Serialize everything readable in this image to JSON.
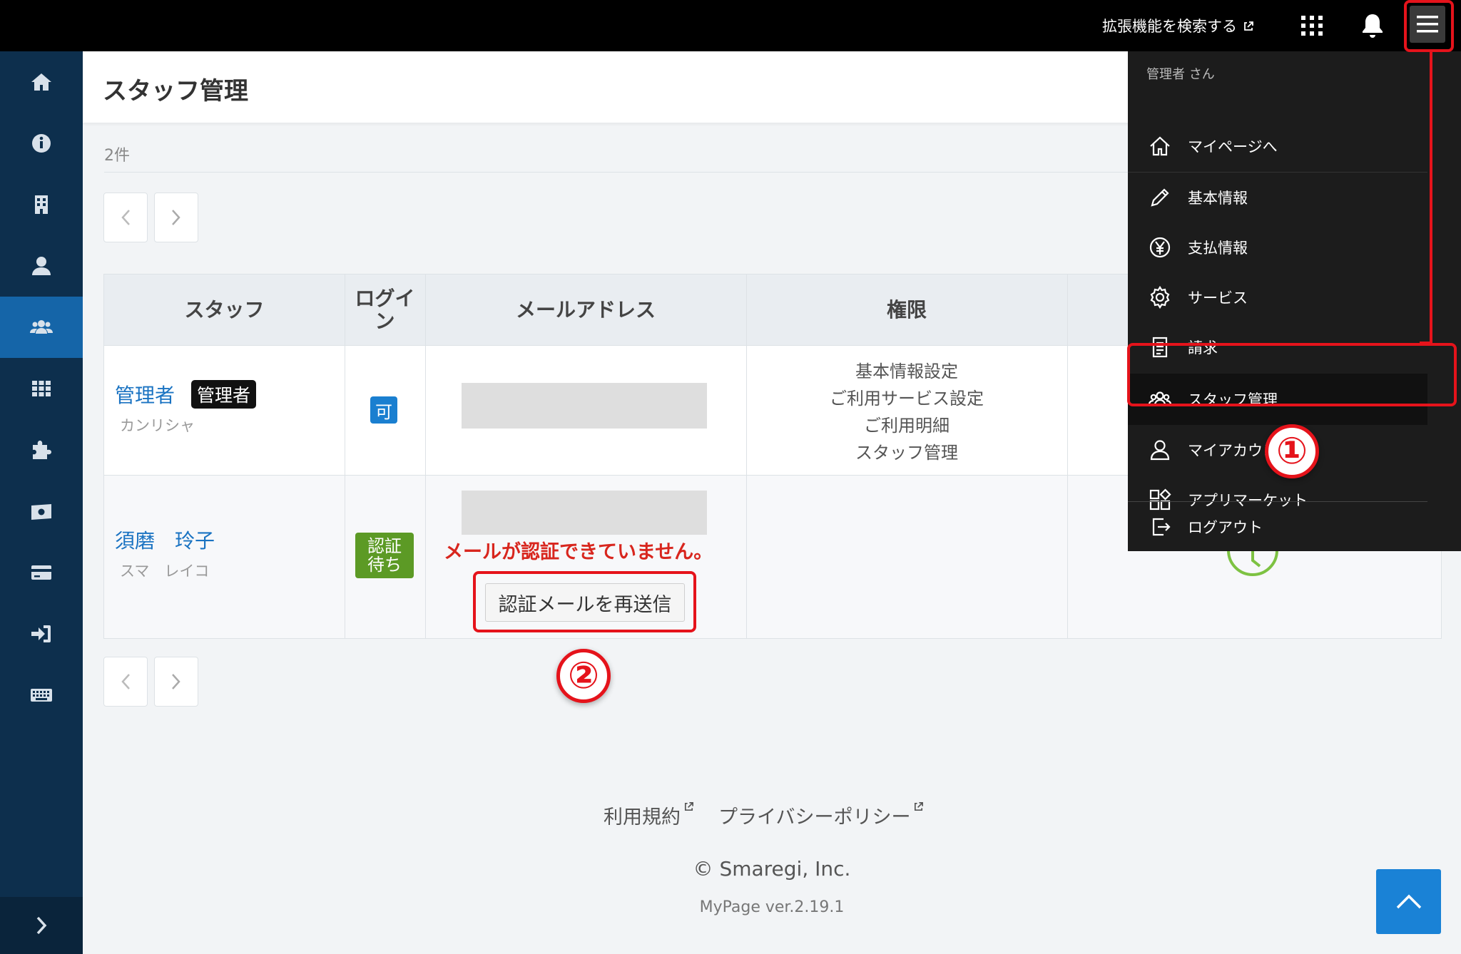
{
  "topbar": {
    "ext_link_label": "拡張機能を検索する"
  },
  "header": {
    "title": "スタッフ管理"
  },
  "list": {
    "count_label": "2件"
  },
  "table": {
    "columns": [
      "スタッフ",
      "ログイン",
      "メールアドレス",
      "権限"
    ],
    "column_login_line1": "ログイ",
    "column_login_line2": "ン",
    "rows": [
      {
        "name": "管理者",
        "role_badge": "管理者",
        "kana": "カンリシャ",
        "login_status": "可",
        "permissions": [
          "基本情報設定",
          "ご利用サービス設定",
          "ご利用明細",
          "スタッフ管理"
        ]
      },
      {
        "name": "須磨　玲子",
        "kana": "スマ　レイコ",
        "login_status_line1": "認証",
        "login_status_line2": "待ち",
        "email_warning": "メールが認証できていません。",
        "resend_button": "認証メールを再送信"
      }
    ]
  },
  "dropdown": {
    "user_label": "管理者 さん",
    "items": [
      {
        "label": "マイページへ",
        "icon": "home-outline-icon"
      },
      {
        "label": "基本情報",
        "icon": "pencil-icon"
      },
      {
        "label": "支払情報",
        "icon": "yen-icon"
      },
      {
        "label": "サービス",
        "icon": "gear-icon"
      },
      {
        "label": "請求",
        "icon": "document-icon"
      },
      {
        "label": "スタッフ管理",
        "icon": "users-outline-icon"
      },
      {
        "label": "マイアカウント",
        "icon": "user-outline-icon"
      },
      {
        "label": "アプリマーケット",
        "icon": "apps-icon"
      },
      {
        "label": "ログアウト",
        "icon": "logout-icon"
      }
    ]
  },
  "annotations": {
    "step1": "①",
    "step2": "②"
  },
  "footer": {
    "terms": "利用規約",
    "privacy": "プライバシーポリシー",
    "copyright": "© Smaregi, Inc.",
    "version": "MyPage ver.2.19.1"
  },
  "colors": {
    "sidebar_bg": "#0d2f4d",
    "sidebar_active": "#1565a8",
    "link_blue": "#1a73c2",
    "warning_red": "#d8261e",
    "annotation_red": "#e5131b",
    "badge_ok": "#1a7fd0",
    "badge_wait": "#5c9a25"
  }
}
